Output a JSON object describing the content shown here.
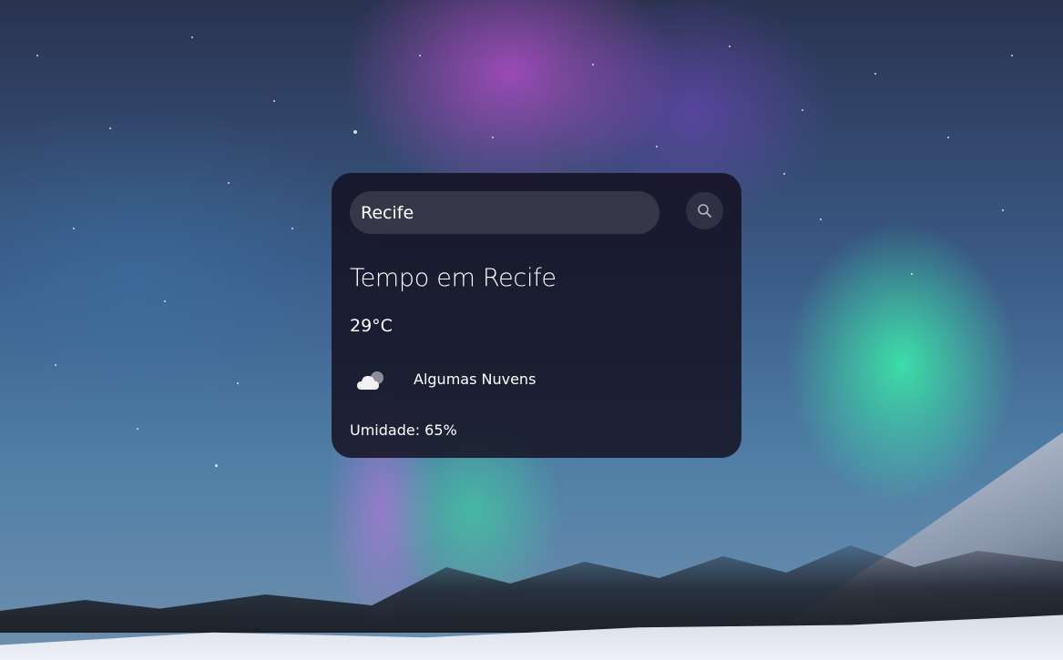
{
  "search": {
    "value": "Recife",
    "button_icon": "search-icon"
  },
  "weather": {
    "title": "Tempo em Recife",
    "temperature": "29°C",
    "condition": "Algumas Nuvens",
    "condition_icon": "cloud-icon",
    "humidity": "Umidade: 65%"
  },
  "colors": {
    "card_background": "#120e1c",
    "text": "#ffffff"
  }
}
